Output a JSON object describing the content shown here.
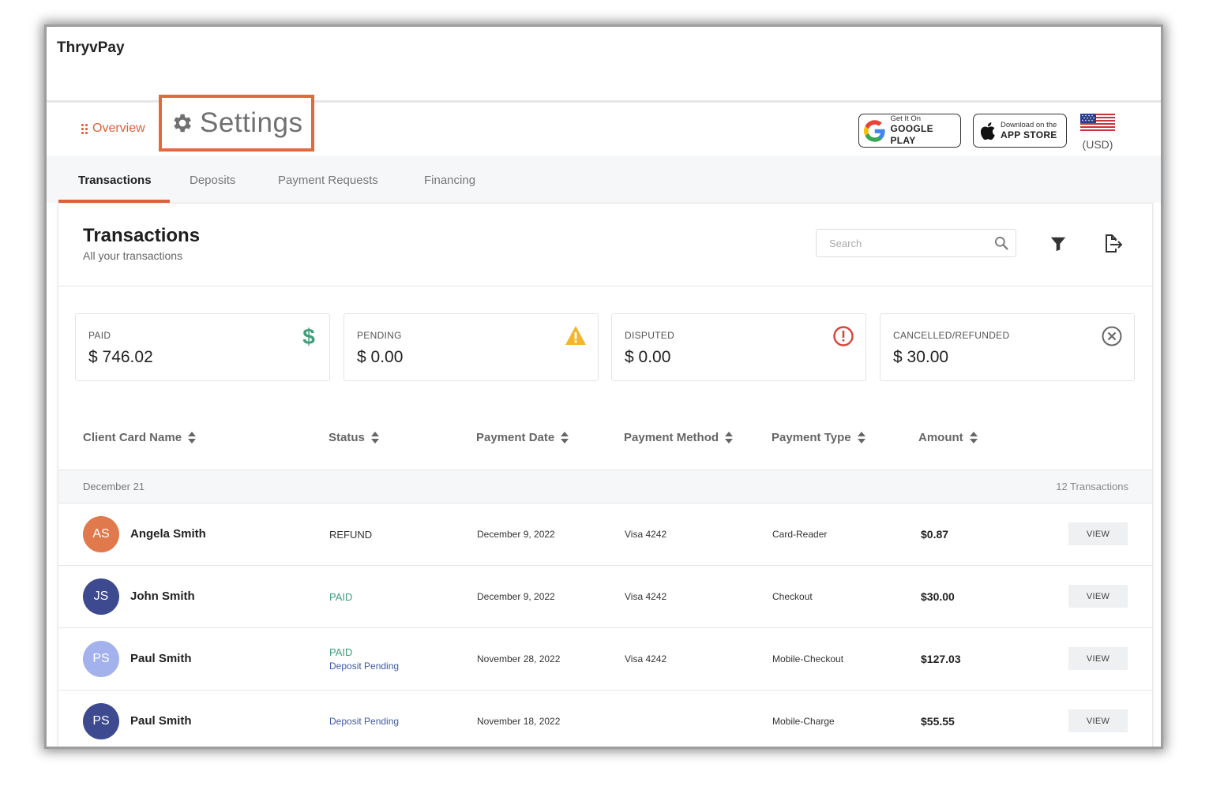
{
  "app": {
    "title": "ThryvPay"
  },
  "nav": {
    "overview_label": "Overview",
    "settings_label": "Settings"
  },
  "stores": {
    "google": {
      "small": "Get It On",
      "big": "GOOGLE PLAY"
    },
    "apple": {
      "small": "Download on the",
      "big": "APP STORE"
    }
  },
  "currency": {
    "label": "(USD)"
  },
  "tabs": [
    {
      "label": "Transactions",
      "active": true
    },
    {
      "label": "Deposits",
      "active": false
    },
    {
      "label": "Payment Requests",
      "active": false
    },
    {
      "label": "Financing",
      "active": false
    }
  ],
  "panel": {
    "title": "Transactions",
    "subtitle": "All your transactions",
    "search_placeholder": "Search"
  },
  "stats": [
    {
      "label": "PAID",
      "value": "$ 746.02",
      "icon": "dollar-icon",
      "color": "#3e9e7a"
    },
    {
      "label": "PENDING",
      "value": "$ 0.00",
      "icon": "warning-icon",
      "color": "#f2b52c"
    },
    {
      "label": "DISPUTED",
      "value": "$ 0.00",
      "icon": "alert-circle-icon",
      "color": "#d8453a"
    },
    {
      "label": "CANCELLED/REFUNDED",
      "value": "$ 30.00",
      "icon": "x-circle-icon",
      "color": "#666666"
    }
  ],
  "columns": [
    {
      "label": "Client Card Name"
    },
    {
      "label": "Status"
    },
    {
      "label": "Payment Date"
    },
    {
      "label": "Payment Method"
    },
    {
      "label": "Payment Type"
    },
    {
      "label": "Amount"
    }
  ],
  "group": {
    "date": "December 21",
    "count": "12 Transactions"
  },
  "rows": [
    {
      "initials": "AS",
      "avatar_color": "#e07a4d",
      "name": "Angela Smith",
      "status1": "REFUND",
      "status2": "",
      "date": "December 9, 2022",
      "method": "Visa 4242",
      "type": "Card-Reader",
      "amount": "$0.87",
      "view": "VIEW"
    },
    {
      "initials": "JS",
      "avatar_color": "#3d4a8f",
      "name": "John Smith",
      "status1": "PAID",
      "status2": "",
      "date": "December 9, 2022",
      "method": "Visa 4242",
      "type": "Checkout",
      "amount": "$30.00",
      "view": "VIEW"
    },
    {
      "initials": "PS",
      "avatar_color": "#a3b2ec",
      "name": "Paul Smith",
      "status1": "PAID",
      "status2": "Deposit Pending",
      "date": "November 28, 2022",
      "method": "Visa 4242",
      "type": "Mobile-Checkout",
      "amount": "$127.03",
      "view": "VIEW"
    },
    {
      "initials": "PS",
      "avatar_color": "#3d4a8f",
      "name": "Paul Smith",
      "status1": "",
      "status2": "Deposit Pending",
      "date": "November 18, 2022",
      "method": "",
      "type": "Mobile-Charge",
      "amount": "$55.55",
      "view": "VIEW"
    }
  ]
}
